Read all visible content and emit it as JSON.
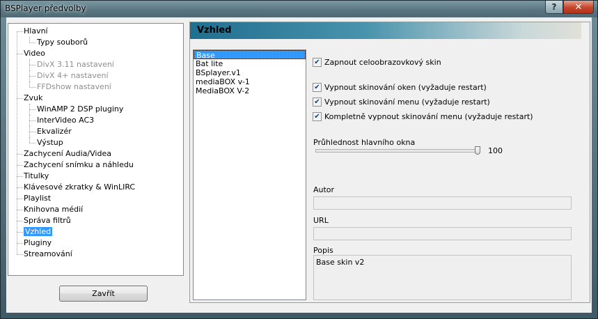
{
  "window": {
    "title": "BSPlayer předvolby",
    "help_label": "?",
    "close_label": "✕"
  },
  "tree": {
    "items": [
      {
        "label": "Hlavní",
        "level": 0,
        "disabled": false
      },
      {
        "label": "Typy souborů",
        "level": 1,
        "disabled": false
      },
      {
        "label": "Video",
        "level": 0,
        "disabled": false
      },
      {
        "label": "DivX 3.11 nastavení",
        "level": 1,
        "disabled": true
      },
      {
        "label": "DivX 4+ nastavení",
        "level": 1,
        "disabled": true
      },
      {
        "label": "FFDshow nastavení",
        "level": 1,
        "disabled": true
      },
      {
        "label": "Zvuk",
        "level": 0,
        "disabled": false
      },
      {
        "label": "WinAMP 2 DSP pluginy",
        "level": 1,
        "disabled": false
      },
      {
        "label": "InterVideo AC3",
        "level": 1,
        "disabled": false
      },
      {
        "label": "Ekvalizér",
        "level": 1,
        "disabled": false
      },
      {
        "label": "Výstup",
        "level": 1,
        "disabled": false
      },
      {
        "label": "Zachycení Audia/Videa",
        "level": 0,
        "disabled": false
      },
      {
        "label": "Zachycení snímku a náhledu",
        "level": 0,
        "disabled": false
      },
      {
        "label": "Titulky",
        "level": 0,
        "disabled": false
      },
      {
        "label": "Klávesové zkratky & WinLIRC",
        "level": 0,
        "disabled": false
      },
      {
        "label": "Playlist",
        "level": 0,
        "disabled": false
      },
      {
        "label": "Knihovna médií",
        "level": 0,
        "disabled": false
      },
      {
        "label": "Správa filtrů",
        "level": 0,
        "disabled": false
      },
      {
        "label": "Vzhled",
        "level": 0,
        "disabled": false,
        "selected": true
      },
      {
        "label": "Pluginy",
        "level": 0,
        "disabled": false
      },
      {
        "label": "Streamování",
        "level": 0,
        "disabled": false
      }
    ]
  },
  "close_button": {
    "label": "Zavřít"
  },
  "section": {
    "title": "Vzhled"
  },
  "skins": {
    "items": [
      "Base",
      "Bat lite",
      "BSplayer.v1",
      "mediaBOX v-1",
      "MediaBOX V-2"
    ],
    "selected_index": 0
  },
  "options": {
    "fullscreen_skin": {
      "label": "Zapnout celoobrazovkový skin",
      "checked": true
    },
    "disable_window_skin": {
      "label": "Vypnout skinování oken (vyžaduje restart)",
      "checked": true
    },
    "disable_menu_skin": {
      "label": "Vypnout skinování menu (vyžaduje restart)",
      "checked": true
    },
    "disable_menu_full": {
      "label": "Kompletně vypnout skinování menu (vyžaduje restart)",
      "checked": true
    }
  },
  "transparency": {
    "label": "Průhlednost hlavního okna",
    "value": 100,
    "max": 100
  },
  "author": {
    "label": "Autor",
    "value": ""
  },
  "url": {
    "label": "URL",
    "value": ""
  },
  "description": {
    "label": "Popis",
    "value": "Base skin v2"
  }
}
